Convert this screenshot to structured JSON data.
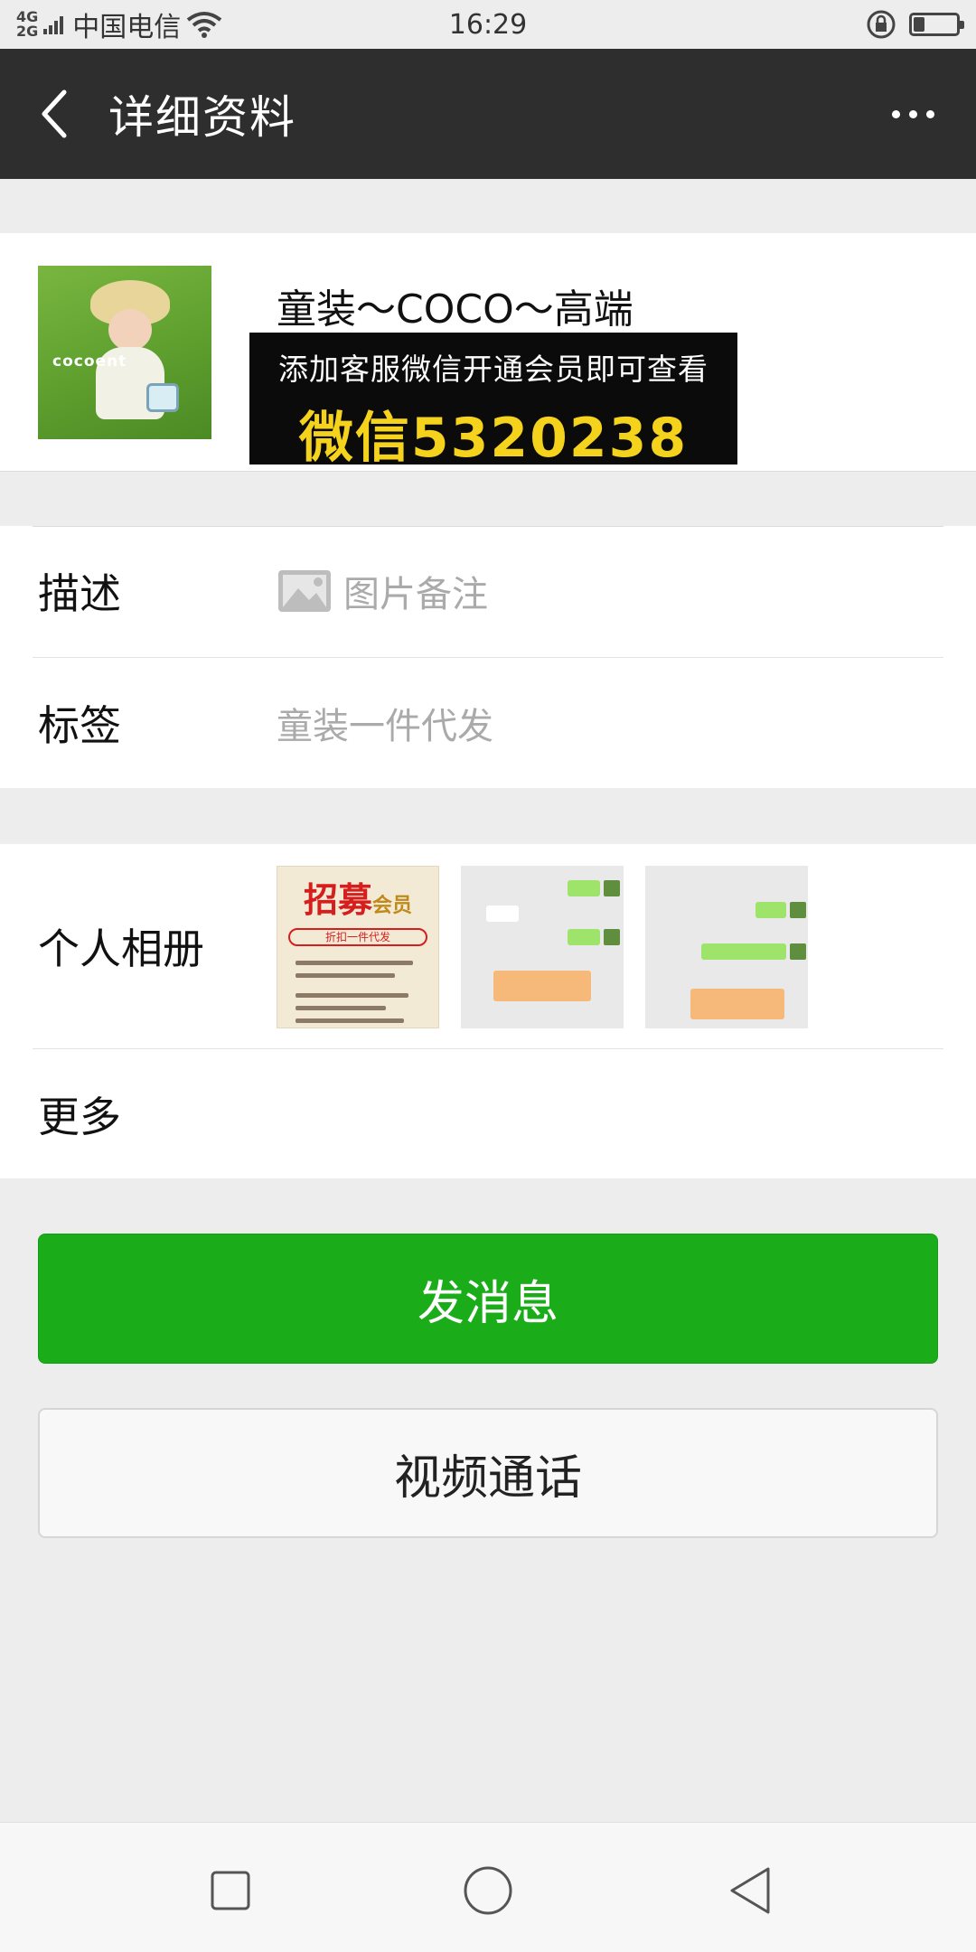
{
  "status_bar": {
    "network_top": "4G",
    "network_bottom": "2G",
    "carrier": "中国电信",
    "time": "16:29",
    "battery_level": 0.25
  },
  "nav": {
    "title": "详细资料",
    "back_icon": "chevron-left-icon",
    "more_icon": "more-dots-icon"
  },
  "profile": {
    "name": "童装～COCO～高端",
    "avatar_text": "cocoent",
    "ad_line1": "添加客服微信开通会员即可查看",
    "ad_line2": "微信5320238",
    "ad_highlight_color": "#f5d21c"
  },
  "info_rows": {
    "description": {
      "label": "描述",
      "value": "图片备注",
      "icon": "image-icon"
    },
    "tags": {
      "label": "标签",
      "value": "童装一件代发"
    }
  },
  "album": {
    "label": "个人相册",
    "poster_title": "招募",
    "poster_tag": "会员",
    "poster_subtitle": "折扣一件代发"
  },
  "more": {
    "label": "更多"
  },
  "actions": {
    "message_label": "发消息",
    "video_call_label": "视频通话",
    "primary_color": "#1aad19"
  },
  "system_nav": {
    "recents_icon": "square-icon",
    "home_icon": "circle-icon",
    "back_icon": "triangle-back-icon"
  }
}
